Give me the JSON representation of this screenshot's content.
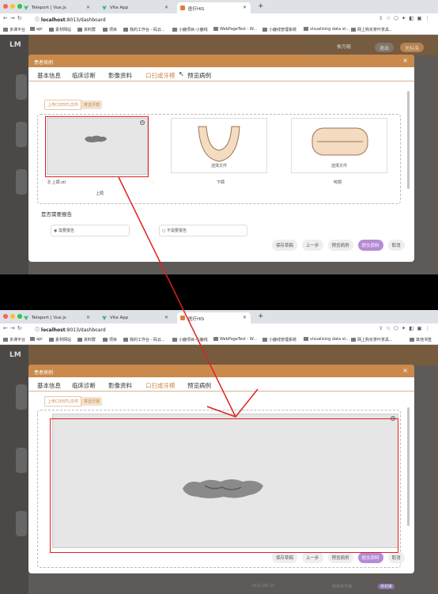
{
  "browser": {
    "tabs": [
      {
        "label": "Teleport | Vue.js"
      },
      {
        "label": "Vite App"
      },
      {
        "label": "医疗HIS"
      }
    ],
    "url_host": "localhost",
    "url_path": ":8013/dashboard",
    "bookmarks": [
      "多课平台",
      "api",
      "素材网站",
      "资料群",
      "项目",
      "我的工作台 - 码云...",
      "小鹿项目-小鹿线",
      "WebPageTest - W...",
      "小鹿线管理系统",
      "visualising data st...",
      "网上购买茶叶茶具...",
      "其他书签"
    ],
    "icon_names": [
      "back-icon",
      "forward-icon",
      "reload-icon",
      "share-icon",
      "star-icon",
      "extension-icon",
      "menu-icon"
    ]
  },
  "app": {
    "logo": "LM",
    "user": "侯万聪",
    "header_btn": "退出",
    "sidebar_btn": "关标准"
  },
  "modal": {
    "title": "患者病例",
    "tabs": [
      "基本信息",
      "临床诊断",
      "影像资料",
      "口扫或牙模",
      "预览病例"
    ],
    "active_tab": "口扫或牙模",
    "subtabs": [
      "上传口扫STL文件",
      "寄送牙模"
    ],
    "upload_cards": [
      {
        "caption": "上颌",
        "file": "上颌.stl"
      },
      {
        "caption": "下颌",
        "hint": "选择文件"
      },
      {
        "caption": "咬颌",
        "hint": "选择文件"
      }
    ],
    "report_question": "是否需要报告",
    "report_options": [
      "需要报告",
      "不需要报告"
    ],
    "footer_buttons": [
      "保存草稿",
      "上一步",
      "预览病例",
      "提交资料",
      "取消"
    ]
  },
  "background_row": {
    "date": "2022-06-27",
    "status": "待初审不得",
    "tag": "待初审"
  },
  "colors": {
    "accent": "#c98a4b",
    "primary_button": "#b58bd6",
    "annotation": "#e02020"
  }
}
